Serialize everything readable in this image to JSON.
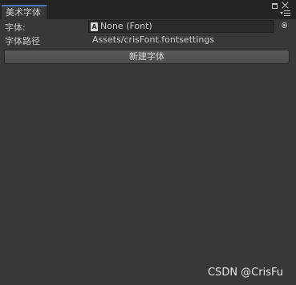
{
  "tab": {
    "title": "美术字体"
  },
  "window_buttons": {
    "icons": [
      "maximize-icon",
      "close-icon",
      "menu-icon"
    ]
  },
  "font_row": {
    "label": "字体:",
    "value": "None (Font)",
    "icon": "font-icon"
  },
  "path_row": {
    "label": "字体路径",
    "value": "Assets/crisFont.fontsettings"
  },
  "create_button": {
    "label": "新建字体"
  },
  "watermark": {
    "text": "CSDN @CrisFu"
  },
  "colors": {
    "background": "#383838",
    "tabbar": "#242424",
    "tab_accent": "#4a78c2",
    "field": "#2a2a2a",
    "button": "#555555"
  }
}
